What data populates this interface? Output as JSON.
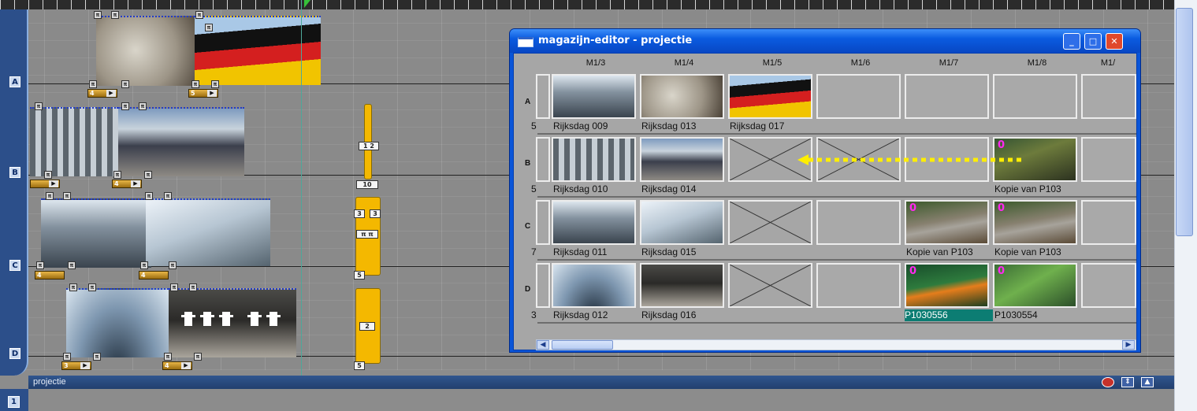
{
  "tracks": [
    "A",
    "B",
    "C",
    "D"
  ],
  "timeline": {
    "tags": [
      "4",
      "5",
      "4",
      "4",
      "3",
      "4",
      "3",
      "4"
    ],
    "yellow_labels": [
      "10",
      "3",
      "3",
      "5",
      "5"
    ],
    "panel_label": "projectie",
    "lower_track": "1"
  },
  "window": {
    "title": "magazijn-editor - projectie",
    "columns": [
      "M1/3",
      "M1/4",
      "M1/5",
      "M1/6",
      "M1/7",
      "M1/8",
      "M1/"
    ],
    "rows": [
      "A",
      "B",
      "C",
      "D"
    ],
    "captions": {
      "A": [
        "Rijksdag 009",
        "Rijksdag 013",
        "Rijksdag 017",
        "",
        "",
        ""
      ],
      "B": [
        "Rijksdag 010",
        "Rijksdag 014",
        "",
        "",
        "",
        "Kopie van P103"
      ],
      "C": [
        "Rijksdag 011",
        "Rijksdag 015",
        "",
        "",
        "Kopie van P103",
        "Kopie van P103"
      ],
      "D": [
        "Rijksdag 012",
        "Rijksdag 016",
        "",
        "",
        "P1030556",
        "P1030554"
      ]
    },
    "left_edge_captions": [
      "5",
      "5",
      "7",
      "3"
    ],
    "markers": [
      "0",
      "0",
      "0",
      "0",
      "0"
    ]
  },
  "colors": {
    "accent": "#0a55d8",
    "selection": "#0c7d73",
    "tag": "#f4b800",
    "marker": "#ff28f0",
    "arrow": "#ffee00"
  }
}
